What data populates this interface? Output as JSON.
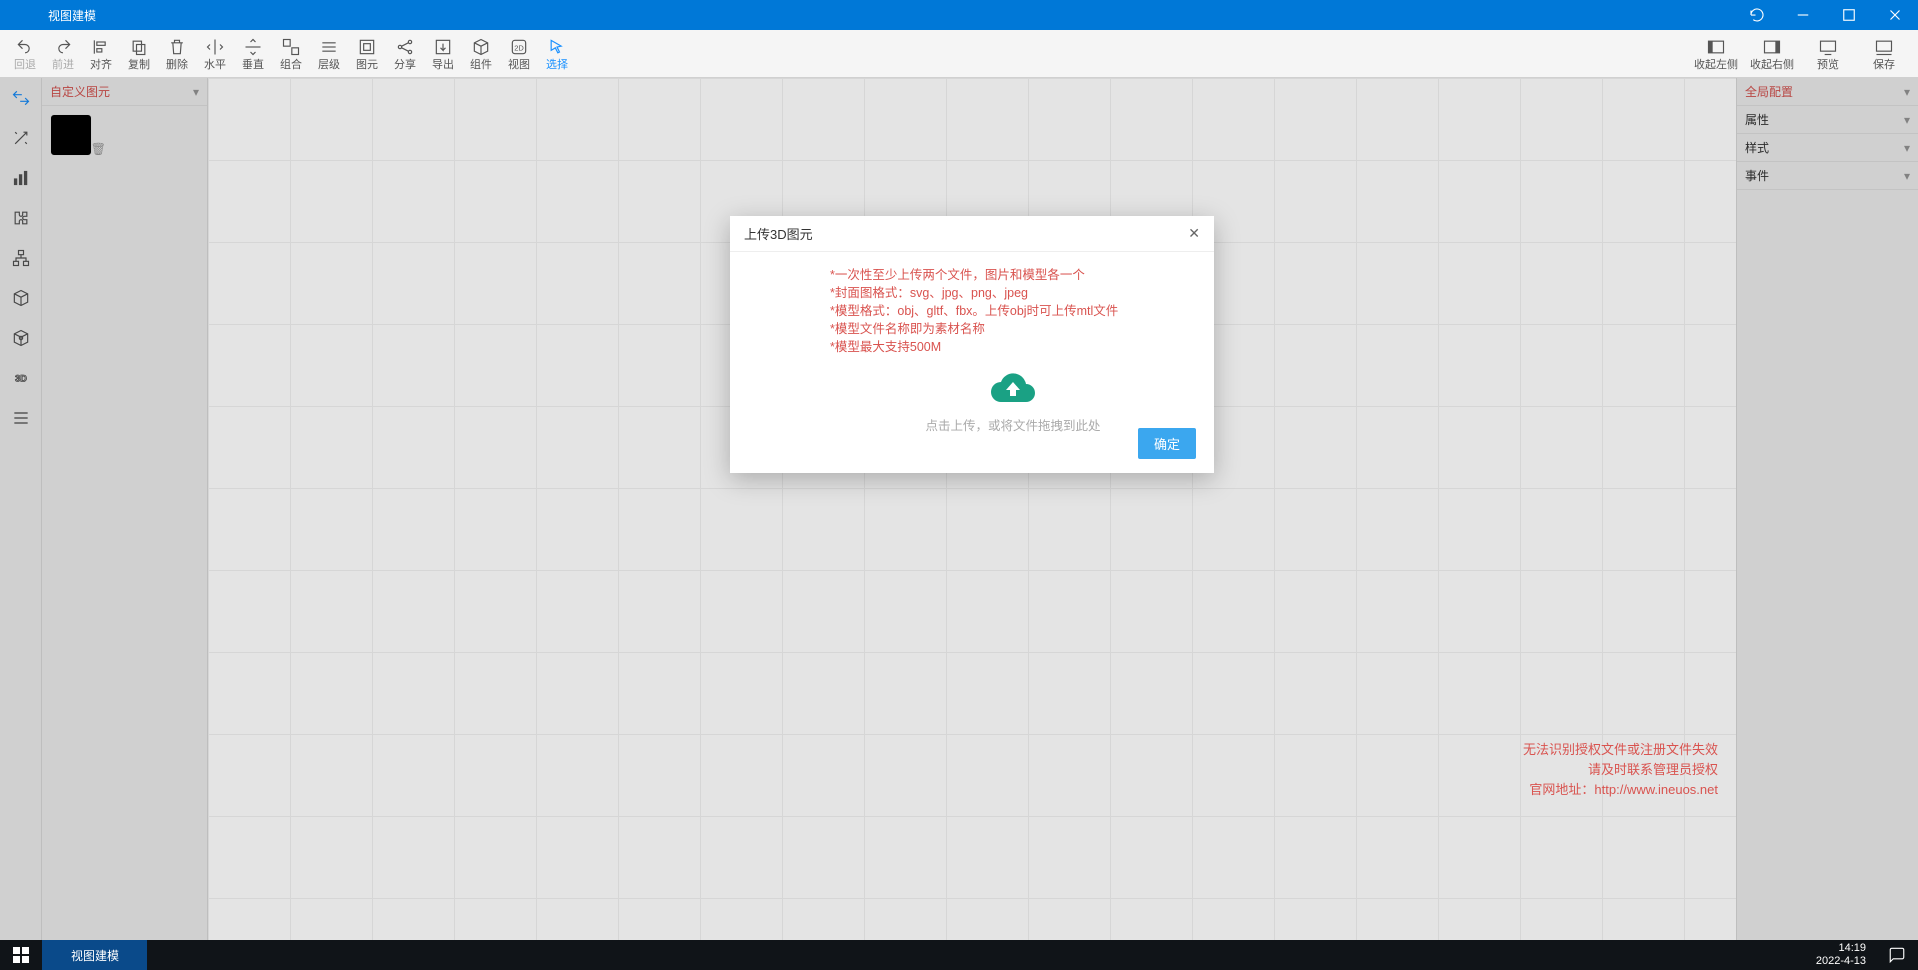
{
  "titlebar": {
    "title": "视图建模"
  },
  "toolbar_left": [
    {
      "label": "回退",
      "icon": "undo",
      "disabled": true
    },
    {
      "label": "前进",
      "icon": "redo",
      "disabled": true
    },
    {
      "label": "对齐",
      "icon": "align"
    },
    {
      "label": "复制",
      "icon": "copy"
    },
    {
      "label": "删除",
      "icon": "delete"
    },
    {
      "label": "水平",
      "icon": "horiz"
    },
    {
      "label": "垂直",
      "icon": "vert"
    },
    {
      "label": "组合",
      "icon": "group"
    },
    {
      "label": "层级",
      "icon": "layer"
    },
    {
      "label": "图元",
      "icon": "element"
    },
    {
      "label": "分享",
      "icon": "share"
    },
    {
      "label": "导出",
      "icon": "export"
    },
    {
      "label": "组件",
      "icon": "component"
    },
    {
      "label": "视图",
      "icon": "view2d"
    },
    {
      "label": "选择",
      "icon": "select",
      "active": true
    }
  ],
  "toolbar_right": [
    {
      "label": "收起左侧",
      "icon": "panel-left"
    },
    {
      "label": "收起右侧",
      "icon": "panel-right"
    },
    {
      "label": "预览",
      "icon": "preview"
    },
    {
      "label": "保存",
      "icon": "save"
    }
  ],
  "left_panel": {
    "header": "自定义图元"
  },
  "right_panel": {
    "items": [
      "全局配置",
      "属性",
      "样式",
      "事件"
    ]
  },
  "license": {
    "line1": "无法识别授权文件或注册文件失效",
    "line2": "请及时联系管理员授权",
    "line3_prefix": "官网地址：",
    "url": "http://www.ineuos.net"
  },
  "dialog": {
    "title": "上传3D图元",
    "rules": [
      "*一次性至少上传两个文件，图片和模型各一个",
      "*封面图格式：svg、jpg、png、jpeg",
      "*模型格式：obj、gltf、fbx。上传obj时可上传mtl文件",
      "*模型文件名称即为素材名称",
      "*模型最大支持500M"
    ],
    "upload_text": "点击上传，或将文件拖拽到此处",
    "ok": "确定"
  },
  "taskbar": {
    "task": "视图建模",
    "time": "14:19",
    "date": "2022-4-13"
  },
  "rail_items": [
    "swap",
    "magic",
    "bars",
    "puzzle",
    "hier",
    "cube",
    "cube3d",
    "3d",
    "list"
  ]
}
